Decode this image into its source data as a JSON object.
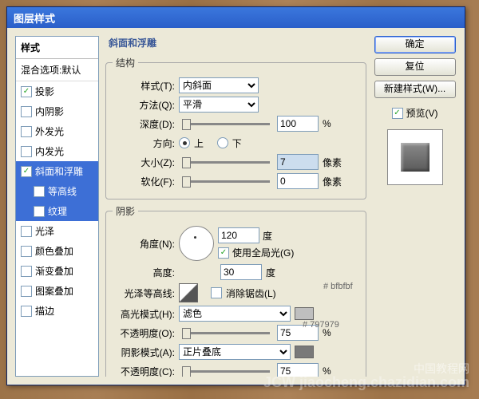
{
  "window": {
    "title": "图层样式"
  },
  "stylelist": {
    "header": "样式",
    "blend": "混合选项:默认",
    "items": [
      {
        "label": "投影",
        "checked": true,
        "selected": false
      },
      {
        "label": "内阴影",
        "checked": false,
        "selected": false
      },
      {
        "label": "外发光",
        "checked": false,
        "selected": false
      },
      {
        "label": "内发光",
        "checked": false,
        "selected": false
      },
      {
        "label": "斜面和浮雕",
        "checked": true,
        "selected": true
      },
      {
        "label": "等高线",
        "checked": false,
        "selected": true,
        "sub": true
      },
      {
        "label": "纹理",
        "checked": false,
        "selected": true,
        "sub": true
      },
      {
        "label": "光泽",
        "checked": false,
        "selected": false
      },
      {
        "label": "颜色叠加",
        "checked": false,
        "selected": false
      },
      {
        "label": "渐变叠加",
        "checked": false,
        "selected": false
      },
      {
        "label": "图案叠加",
        "checked": false,
        "selected": false
      },
      {
        "label": "描边",
        "checked": false,
        "selected": false
      }
    ]
  },
  "panel": {
    "title": "斜面和浮雕",
    "structure": {
      "legend": "结构",
      "style_label": "样式(T):",
      "style_value": "内斜面",
      "technique_label": "方法(Q):",
      "technique_value": "平滑",
      "depth_label": "深度(D):",
      "depth_value": "100",
      "depth_unit": "%",
      "direction_label": "方向:",
      "up": "上",
      "down": "下",
      "size_label": "大小(Z):",
      "size_value": "7",
      "size_unit": "像素",
      "soften_label": "软化(F):",
      "soften_value": "0",
      "soften_unit": "像素"
    },
    "shading": {
      "legend": "阴影",
      "angle_label": "角度(N):",
      "angle_value": "120",
      "angle_unit": "度",
      "global_light": "使用全局光(G)",
      "altitude_label": "高度:",
      "altitude_value": "30",
      "altitude_unit": "度",
      "gloss_label": "光泽等高线:",
      "antialias": "消除锯齿(L)",
      "highlight_mode_label": "高光模式(H):",
      "highlight_mode_value": "滤色",
      "highlight_opacity_label": "不透明度(O):",
      "highlight_opacity_value": "75",
      "pct": "%",
      "shadow_mode_label": "阴影模式(A):",
      "shadow_mode_value": "正片叠底",
      "shadow_opacity_label": "不透明度(C):",
      "shadow_opacity_value": "75"
    },
    "colors": {
      "highlight": "#bfbfbf",
      "shadow": "#797979"
    }
  },
  "buttons": {
    "ok": "确定",
    "reset": "复位",
    "newstyle": "新建样式(W)...",
    "preview": "预览(V)"
  },
  "annotations": {
    "hl": "# bfbfbf",
    "sh": "# 797979"
  },
  "watermark": {
    "cn": "中国教程网",
    "en": "JCW jiaocheng.chazidian.com"
  }
}
